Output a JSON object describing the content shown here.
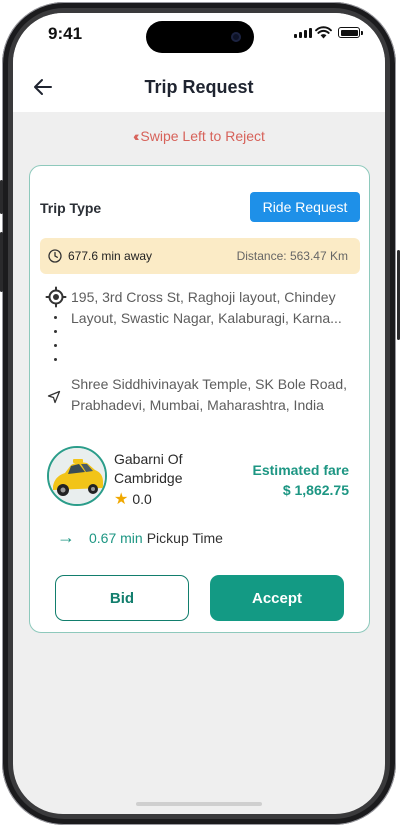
{
  "status_bar": {
    "time": "9:41"
  },
  "header": {
    "title": "Trip Request"
  },
  "swipe": {
    "chevrons": "‹‹",
    "label": "Swipe Left to Reject"
  },
  "card": {
    "trip_type_label": "Trip Type",
    "ride_request_label": "Ride Request",
    "eta": "677.6 min away",
    "distance": "Distance: 563.47 Km",
    "pickup_address": "195, 3rd Cross St, Raghoji layout, Chindey Layout, Swastic Nagar, Kalaburagi, Karna...",
    "drop_address": "Shree Siddhivinayak Temple, SK Bole Road, Prabhadevi, Mumbai, Maharashtra, India",
    "driver": {
      "name": "Gabarni Of Cambridge",
      "rating": "0.0"
    },
    "fare": {
      "label": "Estimated fare",
      "value": "$ 1,862.75"
    },
    "pickup_time": {
      "minutes": "0.67 min",
      "label": "Pickup Time"
    },
    "bid_label": "Bid",
    "accept_label": "Accept"
  },
  "colors": {
    "accent": "#139a84",
    "ride_request": "#1e90e8",
    "reject": "#d7625a",
    "info_bar": "#fbebc6"
  },
  "icons": [
    "back-arrow-icon",
    "swipe-chevron-icon",
    "clock-icon",
    "target-pin-icon",
    "navigation-arrow-icon",
    "taxi-avatar",
    "star-icon",
    "right-arrow-icon"
  ]
}
